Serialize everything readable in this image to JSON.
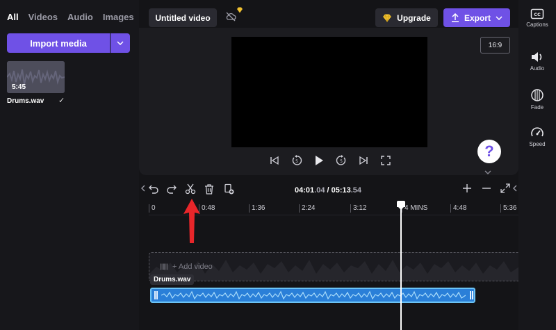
{
  "media_panel": {
    "tabs": [
      {
        "label": "All",
        "active": true
      },
      {
        "label": "Videos",
        "active": false
      },
      {
        "label": "Audio",
        "active": false
      },
      {
        "label": "Images",
        "active": false
      }
    ],
    "import_label": "Import media",
    "item": {
      "duration": "5:45",
      "name": "Drums.wav"
    }
  },
  "header": {
    "title": "Untitled video",
    "upgrade_label": "Upgrade",
    "export_label": "Export",
    "aspect_ratio": "16:9"
  },
  "help": {
    "label": "?"
  },
  "tool_rail": [
    {
      "label": "Captions",
      "icon": "captions-icon"
    },
    {
      "label": "Audio",
      "icon": "speaker-icon"
    },
    {
      "label": "Fade",
      "icon": "fade-icon"
    },
    {
      "label": "Speed",
      "icon": "speedometer-icon"
    }
  ],
  "timeline": {
    "current_time_main": "04:01",
    "current_time_frac": ".04",
    "separator": " / ",
    "total_time_main": "05:13",
    "total_time_frac": ".54",
    "ruler_labels": [
      "0",
      "0:48",
      "1:36",
      "2:24",
      "3:12",
      "4 MINS",
      "4:48",
      "5:36"
    ],
    "add_video_label": "+ Add video",
    "audio_clip_name": "Drums.wav"
  },
  "colors": {
    "accent": "#6f51e6",
    "audio_clip": "#2a7fd8",
    "annotation": "#e8262a"
  }
}
